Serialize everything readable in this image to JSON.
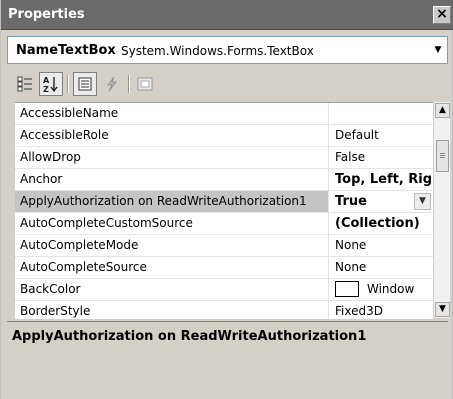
{
  "window": {
    "title": "Properties",
    "close_glyph": "×"
  },
  "object_selector": {
    "name": "NameTextBox",
    "type": "System.Windows.Forms.TextBox",
    "dropdown_icon": "triangle-down-icon"
  },
  "toolbar": {
    "buttons": [
      {
        "name": "categorized",
        "icon": "categorized-icon",
        "pressed": false
      },
      {
        "name": "alphabetical",
        "icon": "alphabetical-sort-icon",
        "pressed": true
      },
      {
        "name": "properties",
        "icon": "properties-icon",
        "pressed": true
      },
      {
        "name": "events",
        "icon": "lightning-bolt-icon",
        "pressed": false
      },
      {
        "name": "property-pages",
        "icon": "property-pages-icon",
        "pressed": false
      }
    ]
  },
  "properties": [
    {
      "name": "AccessibleName",
      "value": ""
    },
    {
      "name": "AccessibleRole",
      "value": "Default"
    },
    {
      "name": "AllowDrop",
      "value": "False"
    },
    {
      "name": "Anchor",
      "value": "Top, Left, Righ"
    },
    {
      "name": "ApplyAuthorization on ReadWriteAuthorization1",
      "value": "True"
    },
    {
      "name": "AutoCompleteCustomSource",
      "value": "(Collection)"
    },
    {
      "name": "AutoCompleteMode",
      "value": "None"
    },
    {
      "name": "AutoCompleteSource",
      "value": "None"
    },
    {
      "name": "BackColor",
      "value": "Window"
    },
    {
      "name": "BorderStyle",
      "value": "Fixed3D"
    }
  ],
  "selected_property": "ApplyAuthorization on ReadWriteAuthorization1",
  "description": {
    "title": "ApplyAuthorization on ReadWriteAuthorization1"
  },
  "colors": {
    "titlebar": "#6b6b6b",
    "window_bg": "#d4d0c8",
    "selection": "#c4c4c4",
    "backcolor_swatch": "#ffffff"
  }
}
